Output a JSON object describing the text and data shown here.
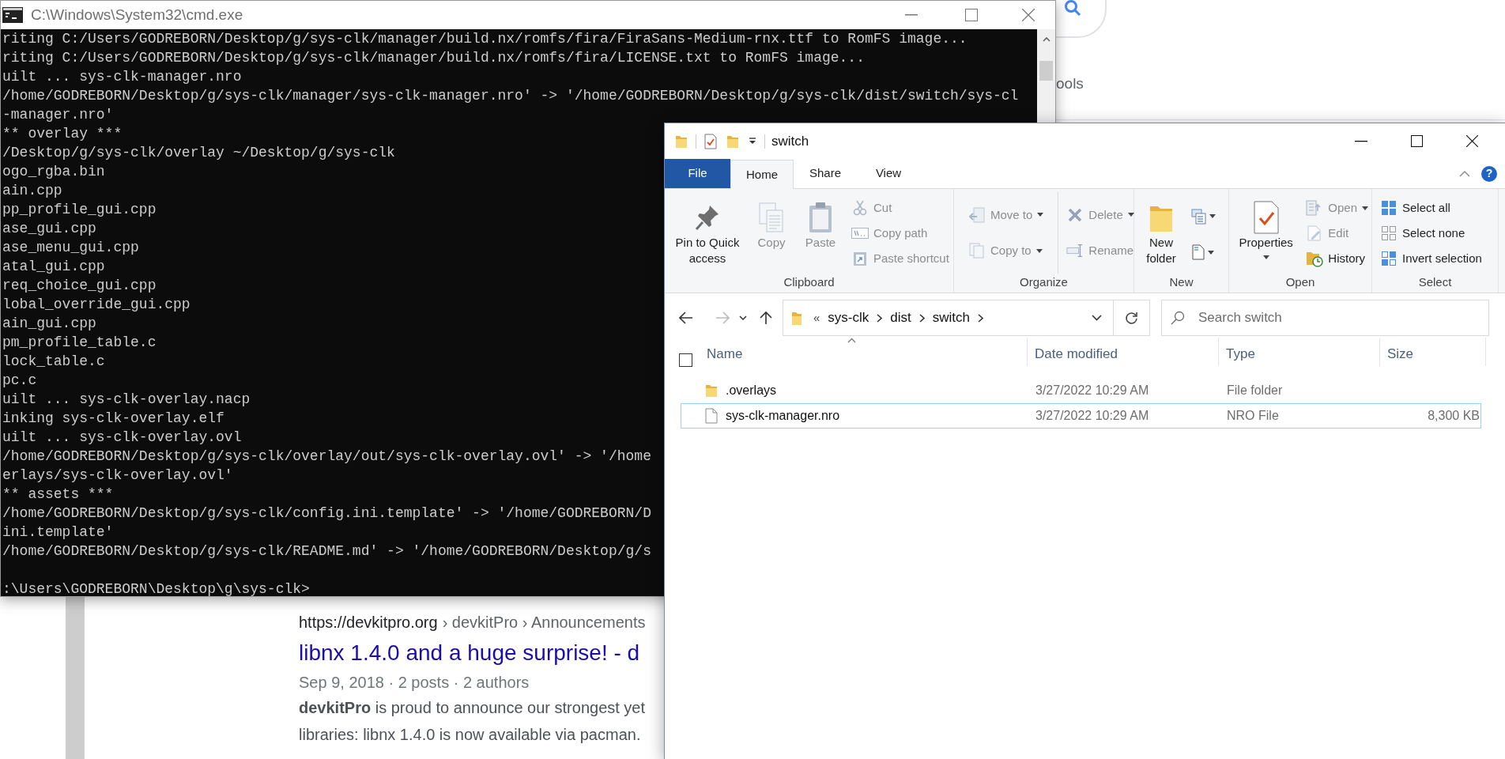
{
  "browser_page": {
    "tools_label": "ools",
    "result": {
      "url": "https://devkitpro.org",
      "breadcrumb": "› devkitPro › Announcements",
      "title": "libnx 1.4.0 and a huge surprise! - d",
      "meta": "Sep 9, 2018 · 2 posts · 2 authors",
      "snippet": [
        "**devkitPro** is proud to announce our strongest yet",
        "libraries: libnx 1.4.0 is now available via pacman."
      ]
    }
  },
  "cmd_window": {
    "title": "C:\\Windows\\System32\\cmd.exe",
    "lines": [
      "riting C:/Users/GODREBORN/Desktop/g/sys-clk/manager/build.nx/romfs/fira/FiraSans-Medium-rnx.ttf to RomFS image...",
      "riting C:/Users/GODREBORN/Desktop/g/sys-clk/manager/build.nx/romfs/fira/LICENSE.txt to RomFS image...",
      "uilt ... sys-clk-manager.nro",
      "/home/GODREBORN/Desktop/g/sys-clk/manager/sys-clk-manager.nro' -> '/home/GODREBORN/Desktop/g/sys-clk/dist/switch/sys-cl",
      "-manager.nro'",
      "** overlay ***",
      "/Desktop/g/sys-clk/overlay ~/Desktop/g/sys-clk",
      "ogo_rgba.bin",
      "ain.cpp",
      "pp_profile_gui.cpp",
      "ase_gui.cpp",
      "ase_menu_gui.cpp",
      "atal_gui.cpp",
      "req_choice_gui.cpp",
      "lobal_override_gui.cpp",
      "ain_gui.cpp",
      "pm_profile_table.c",
      "lock_table.c",
      "pc.c",
      "uilt ... sys-clk-overlay.nacp",
      "inking sys-clk-overlay.elf",
      "uilt ... sys-clk-overlay.ovl",
      "/home/GODREBORN/Desktop/g/sys-clk/overlay/out/sys-clk-overlay.ovl' -> '/home",
      "erlays/sys-clk-overlay.ovl'",
      "** assets ***",
      "/home/GODREBORN/Desktop/g/sys-clk/config.ini.template' -> '/home/GODREBORN/D",
      "ini.template'",
      "/home/GODREBORN/Desktop/g/sys-clk/README.md' -> '/home/GODREBORN/Desktop/g/s"
    ],
    "prompt": ":\\Users\\GODREBORN\\Desktop\\g\\sys-clk>"
  },
  "explorer": {
    "title": "switch",
    "tabs": [
      {
        "label": "File",
        "kind": "file",
        "selected": false
      },
      {
        "label": "Home",
        "kind": "tab",
        "selected": true
      },
      {
        "label": "Share",
        "kind": "tab",
        "selected": false
      },
      {
        "label": "View",
        "kind": "tab",
        "selected": false
      }
    ],
    "help": "?",
    "ribbon": [
      {
        "label": "Clipboard",
        "columns": [
          [
            {
              "kind": "large",
              "label": "Pin to Quick access",
              "disabled": false,
              "dropdown": false
            }
          ],
          [
            {
              "kind": "large",
              "label": "Copy",
              "disabled": true,
              "dropdown": false
            }
          ],
          [
            {
              "kind": "large",
              "label": "Paste",
              "disabled": true,
              "dropdown": false
            }
          ],
          [
            {
              "kind": "small",
              "label": "Cut",
              "disabled": true,
              "dropdown": false
            },
            {
              "kind": "small",
              "label": "Copy path",
              "disabled": true,
              "dropdown": false
            },
            {
              "kind": "small",
              "label": "Paste shortcut",
              "disabled": true,
              "dropdown": false
            }
          ]
        ]
      },
      {
        "label": "Organize",
        "columns": [
          [
            {
              "kind": "small",
              "label": "Move to",
              "disabled": true,
              "dropdown": true
            },
            {
              "kind": "small",
              "label": "Copy to",
              "disabled": true,
              "dropdown": true
            }
          ],
          [
            {
              "kind": "small",
              "label": "Delete",
              "disabled": true,
              "dropdown": true
            },
            {
              "kind": "small",
              "label": "Rename",
              "disabled": true,
              "dropdown": false
            }
          ]
        ]
      },
      {
        "label": "New",
        "columns": [
          [
            {
              "kind": "large",
              "label": "New folder",
              "disabled": false,
              "dropdown": false
            }
          ],
          [
            {
              "kind": "icon",
              "disabled": false,
              "dropdown": true
            },
            {
              "kind": "icon",
              "disabled": false,
              "dropdown": true
            }
          ]
        ]
      },
      {
        "label": "Open",
        "columns": [
          [
            {
              "kind": "large",
              "label": "Properties",
              "disabled": false,
              "dropdown": true
            }
          ],
          [
            {
              "kind": "small",
              "label": "Open",
              "disabled": true,
              "dropdown": true
            },
            {
              "kind": "small",
              "label": "Edit",
              "disabled": true,
              "dropdown": false
            },
            {
              "kind": "small",
              "label": "History",
              "disabled": false,
              "dropdown": false
            }
          ]
        ]
      },
      {
        "label": "Select",
        "columns": [
          [
            {
              "kind": "small",
              "label": "Select all",
              "disabled": false,
              "dropdown": false
            },
            {
              "kind": "small",
              "label": "Select none",
              "disabled": false,
              "dropdown": false
            },
            {
              "kind": "small",
              "label": "Invert selection",
              "disabled": false,
              "dropdown": false
            }
          ]
        ]
      }
    ],
    "address": {
      "overflow": "«",
      "crumbs": [
        "sys-clk",
        "dist",
        "switch"
      ]
    },
    "search": {
      "placeholder": "Search switch"
    },
    "select_all_checked": false,
    "columns": [
      {
        "label": "Name",
        "sorted": true
      },
      {
        "label": "Date modified",
        "sorted": false
      },
      {
        "label": "Type",
        "sorted": false
      },
      {
        "label": "Size",
        "sorted": false
      }
    ],
    "rows": [
      {
        "kind": "folder",
        "name": ".overlays",
        "date": "3/27/2022 10:29 AM",
        "type": "File folder",
        "focused": false
      },
      {
        "kind": "file",
        "name": "sys-clk-manager.nro",
        "date": "3/27/2022 10:29 AM",
        "type": "NRO File",
        "size": "8,300 KB",
        "focused": true
      }
    ]
  }
}
